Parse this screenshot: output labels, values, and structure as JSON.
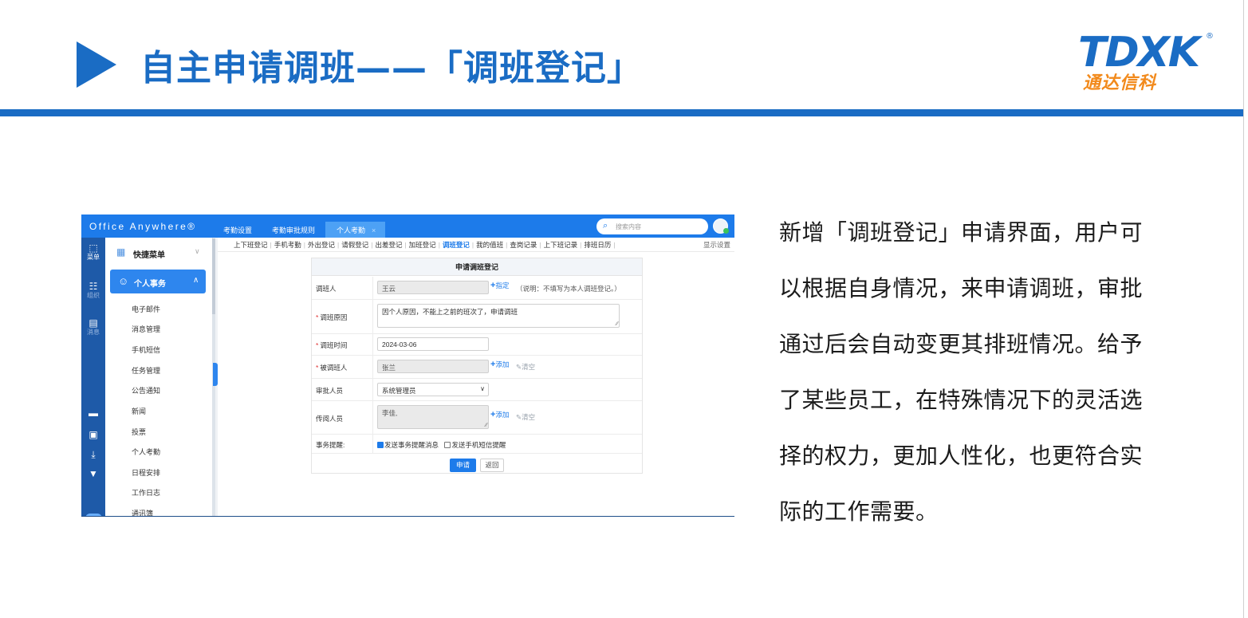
{
  "slide": {
    "title": "自主申请调班——「调班登记」",
    "logo": {
      "mark": "TDXK",
      "registered": "®",
      "subtitle": "通达信科"
    },
    "colors": {
      "accent": "#1a6cc4",
      "logo_orange": "#f28a1c"
    }
  },
  "app": {
    "brand": "Office Anywhere®",
    "top_tabs": [
      {
        "label": "考勤设置",
        "active": false
      },
      {
        "label": "考勤审批规则",
        "active": false
      },
      {
        "label": "个人考勤",
        "active": true,
        "close": "×"
      }
    ],
    "search": {
      "placeholder": "搜索内容",
      "icon": "search-icon"
    },
    "rail": [
      {
        "icon": "apps-grid-icon",
        "label": "菜单"
      },
      {
        "icon": "org-tree-icon",
        "label": "组织"
      },
      {
        "icon": "chat-bubble-icon",
        "label": "消息"
      },
      {
        "icon": "monitor-icon",
        "label": ""
      },
      {
        "icon": "document-icon",
        "label": ""
      },
      {
        "icon": "download-icon",
        "label": ""
      },
      {
        "icon": "shirt-icon",
        "label": ""
      },
      {
        "icon": "toggle-icon",
        "label": ""
      }
    ],
    "menu": {
      "quick": {
        "label": "快捷菜单",
        "icon": "quick-grid-icon"
      },
      "personal": {
        "label": "个人事务",
        "icon": "person-icon"
      },
      "items": [
        "电子邮件",
        "消息管理",
        "手机短信",
        "任务管理",
        "公告通知",
        "新闻",
        "投票",
        "个人考勤",
        "日程安排",
        "工作日志",
        "通讯簿"
      ]
    },
    "subnav": {
      "items": [
        {
          "label": "上下班登记",
          "active": false
        },
        {
          "label": "手机考勤",
          "active": false
        },
        {
          "label": "外出登记",
          "active": false
        },
        {
          "label": "请假登记",
          "active": false
        },
        {
          "label": "出差登记",
          "active": false
        },
        {
          "label": "加班登记",
          "active": false
        },
        {
          "label": "调班登记",
          "active": true
        },
        {
          "label": "我的值班",
          "active": false
        },
        {
          "label": "查岗记录",
          "active": false
        },
        {
          "label": "上下班记录",
          "active": false
        },
        {
          "label": "排班日历",
          "active": false
        }
      ],
      "separator": "|",
      "display_settings": "显示设置"
    },
    "form": {
      "title": "申请调班登记",
      "applicant": {
        "label": "调班人",
        "value": "王云",
        "assign_link": "指定",
        "note": "（说明：不填写为本人调班登记。）"
      },
      "reason": {
        "label": "调班原因",
        "value": "因个人原因，不能上之前的班次了，申请调班"
      },
      "time": {
        "label": "调班时间",
        "value": "2024-03-06"
      },
      "swapped_person": {
        "label": "被调班人",
        "value": "张兰",
        "add": "添加",
        "clear": "清空"
      },
      "approver": {
        "label": "审批人员",
        "value": "系统管理员"
      },
      "circulate": {
        "label": "传阅人员",
        "value": "李佳,",
        "add": "添加",
        "clear": "清空"
      },
      "reminder": {
        "label": "事务提醒:",
        "option_event": "发送事务提醒消息",
        "option_event_checked": true,
        "option_sms": "发送手机短信提醒",
        "option_sms_checked": false
      },
      "required_mark": "*",
      "submit": "申请",
      "back": "返回"
    },
    "colors": {
      "topbar": "#1d7bea",
      "rail": "#1e5aa8",
      "active_menu": "#2e86ee"
    }
  },
  "description": {
    "lines": [
      "新增「调班登记」申请界面，用户可",
      "以根据自身情况，来申请调班，审批",
      "通过后会自动变更其排班情况。给予",
      "了某些员工，在特殊情况下的灵活选",
      "择的权力，更加人性化，也更符合实",
      "际的工作需要。"
    ]
  }
}
